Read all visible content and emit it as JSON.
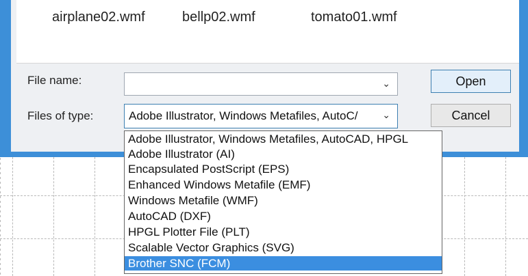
{
  "file_list": {
    "items": [
      "airplane02.wmf",
      "bellp02.wmf",
      "tomato01.wmf"
    ]
  },
  "file_name": {
    "label": "File name:",
    "value": ""
  },
  "files_of_type": {
    "label": "Files of type:",
    "value": "Adobe Illustrator, Windows Metafiles, AutoC/"
  },
  "buttons": {
    "open": "Open",
    "cancel": "Cancel"
  },
  "dropdown": {
    "options": [
      "Adobe Illustrator, Windows Metafiles, AutoCAD, HPGL",
      "Adobe Illustrator (AI)",
      "Encapsulated PostScript (EPS)",
      "Enhanced Windows Metafile (EMF)",
      "Windows Metafile (WMF)",
      "AutoCAD (DXF)",
      "HPGL Plotter File (PLT)",
      "Scalable Vector Graphics (SVG)",
      "Brother SNC (FCM)"
    ],
    "selected_index": 8
  },
  "colors": {
    "accent": "#3b8ee0",
    "window_border": "#3d8fd8"
  }
}
